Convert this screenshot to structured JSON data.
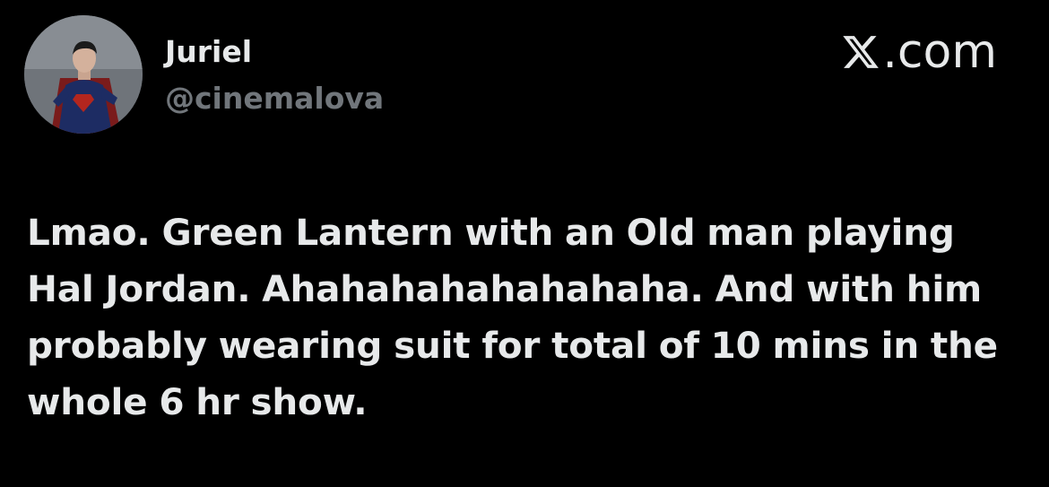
{
  "user": {
    "display_name": "Juriel",
    "handle": "@cinemalova",
    "avatar_icon": "superhero-avatar"
  },
  "brand": {
    "logo_icon": "x-logo-icon",
    "suffix": ".com"
  },
  "tweet": {
    "text": "Lmao. Green Lantern with an Old man playing Hal Jordan. Ahahahahahahahaha. And with him probably wearing suit for total of 10 mins in the whole 6 hr show."
  },
  "colors": {
    "background": "#000000",
    "primary_text": "#e7e9ea",
    "secondary_text": "#71767b"
  }
}
